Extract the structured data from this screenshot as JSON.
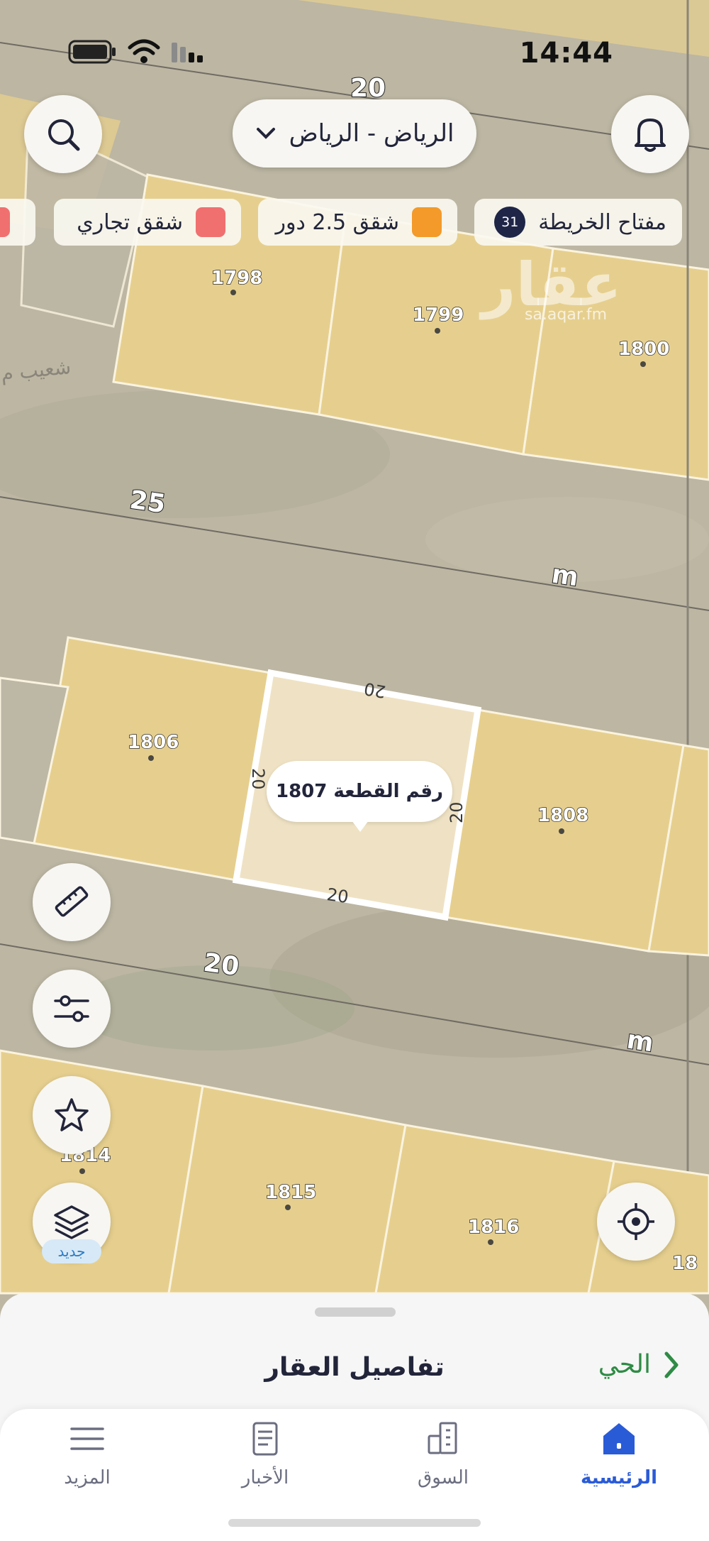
{
  "status": {
    "time": "14:44"
  },
  "header": {
    "city": "الرياض - الرياض"
  },
  "chips": [
    {
      "label": "مفتاح الخريطة",
      "badge": "31"
    },
    {
      "label": "شقق 2.5 دور",
      "color": "#f39a2a"
    },
    {
      "label": "شقق تجاري",
      "color": "#f07070"
    }
  ],
  "map": {
    "watermark": "عقار",
    "watermark_url": "sa.aqar.fm",
    "district_label": "شعيب م",
    "street_widths": [
      "20",
      "25",
      "20"
    ],
    "unit": "m",
    "parcels": [
      "1798",
      "1799",
      "1800",
      "1806",
      "1808",
      "1814",
      "1815",
      "1816",
      "18"
    ],
    "selected": {
      "label": "رقم القطعة 1807",
      "side_top": "20",
      "side_left": "20",
      "side_right": "20",
      "side_bottom": "20"
    }
  },
  "map_tools": {
    "new_tag": "جديد"
  },
  "sheet": {
    "title": "تفاصيل العقار",
    "neighborhood": "الحي"
  },
  "tabs": [
    {
      "label": "الرئيسية",
      "active": true
    },
    {
      "label": "السوق"
    },
    {
      "label": "الأخبار"
    },
    {
      "label": "المزيد"
    }
  ],
  "colors": {
    "accent": "#2a5bd7",
    "plot_fill": "#e6cf8e",
    "green": "#2e8b45"
  }
}
